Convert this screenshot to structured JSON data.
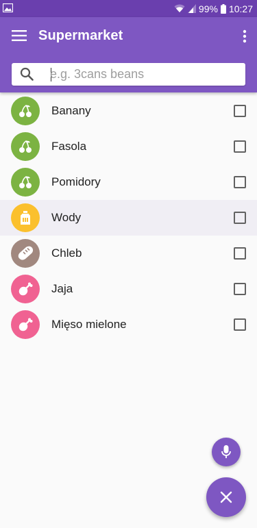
{
  "status_bar": {
    "battery": "99%",
    "time": "10:27"
  },
  "app_bar": {
    "title": "Supermarket"
  },
  "search": {
    "placeholder": "e.g. 3cans beans",
    "value": ""
  },
  "items": [
    {
      "label": "Banany",
      "icon": "cherries-icon",
      "color": "#7cb342",
      "checked": false
    },
    {
      "label": "Fasola",
      "icon": "cherries-icon",
      "color": "#7cb342",
      "checked": false
    },
    {
      "label": "Pomidory",
      "icon": "cherries-icon",
      "color": "#7cb342",
      "checked": false
    },
    {
      "label": "Wody",
      "icon": "water-bottle-icon",
      "color": "#fbc02d",
      "checked": false
    },
    {
      "label": "Chleb",
      "icon": "bread-icon",
      "color": "#a1887f",
      "checked": false
    },
    {
      "label": "Jaja",
      "icon": "drumstick-icon",
      "color": "#f06292",
      "checked": false
    },
    {
      "label": "Mięso mielone",
      "icon": "drumstick-icon",
      "color": "#f06292",
      "checked": false
    }
  ],
  "colors": {
    "accent": "#7e57c2",
    "status_bar": "#6a3fae"
  }
}
